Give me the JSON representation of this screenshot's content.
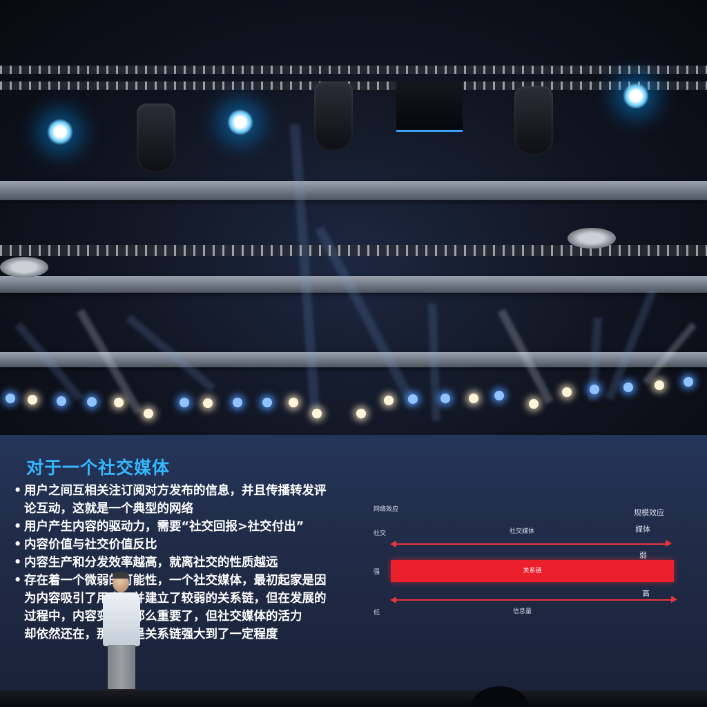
{
  "slide": {
    "title": "对于一个社交媒体",
    "bullet_symbol": "•",
    "bullets": [
      {
        "line1": "用户之间互相关注订阅对方发布的信息，并且传播转发评",
        "line2": "论互动，这就是一个典型的网络"
      },
      {
        "line1": "用户产生内容的驱动力，需要“社交回报>社交付出”"
      },
      {
        "line1": "内容价值与社交价值反比"
      },
      {
        "line1": "内容生产和分发效率越高，就离社交的性质越远"
      },
      {
        "line1": "存在着一个微弱的可能性，一个社交媒体，最初起家是因",
        "line2": "为内容吸引了用户，并建立了较弱的关系链，但在发展的",
        "line3": "过程中，内容变得不那么重要了，但社交媒体的活力",
        "line4": "却依然还在，那一定是关系链强大到了一定程度"
      }
    ]
  },
  "diagram": {
    "network_effect": "网络效应",
    "scale_effect": "规模效应",
    "social": "社交",
    "social_media": "社交媒体",
    "media": "媒体",
    "weak": "弱",
    "strong": "强",
    "relationship_chain": "关系链",
    "high": "高",
    "low": "低",
    "information_amount": "信息量",
    "colors": {
      "red": "#ec1f2c",
      "title_blue": "#35b8ff"
    }
  }
}
